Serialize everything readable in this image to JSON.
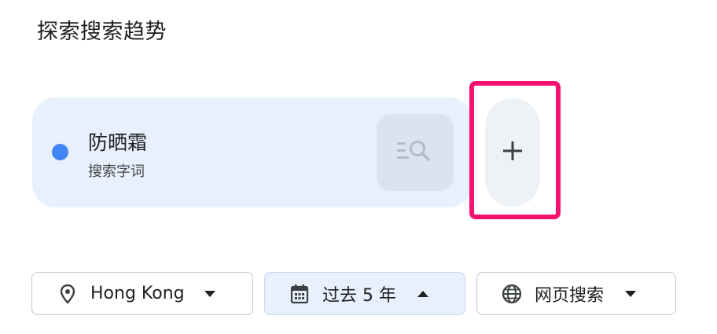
{
  "page": {
    "title": "探索搜索趋势"
  },
  "term_card": {
    "name": "防晒霜",
    "type": "搜索字词",
    "dot_color": "#4285f4",
    "search_icon": "manage-search-icon"
  },
  "add_button": {
    "symbol": "+",
    "highlight_color": "#f5136f"
  },
  "filters": {
    "location": {
      "icon": "location-pin-icon",
      "label": "Hong Kong",
      "caret": "caret-down-icon"
    },
    "time_range": {
      "icon": "calendar-icon",
      "label": "过去 5 年",
      "caret": "caret-up-icon",
      "active": true
    },
    "search_type": {
      "icon": "globe-icon",
      "label": "网页搜索",
      "caret": "caret-down-icon"
    }
  }
}
